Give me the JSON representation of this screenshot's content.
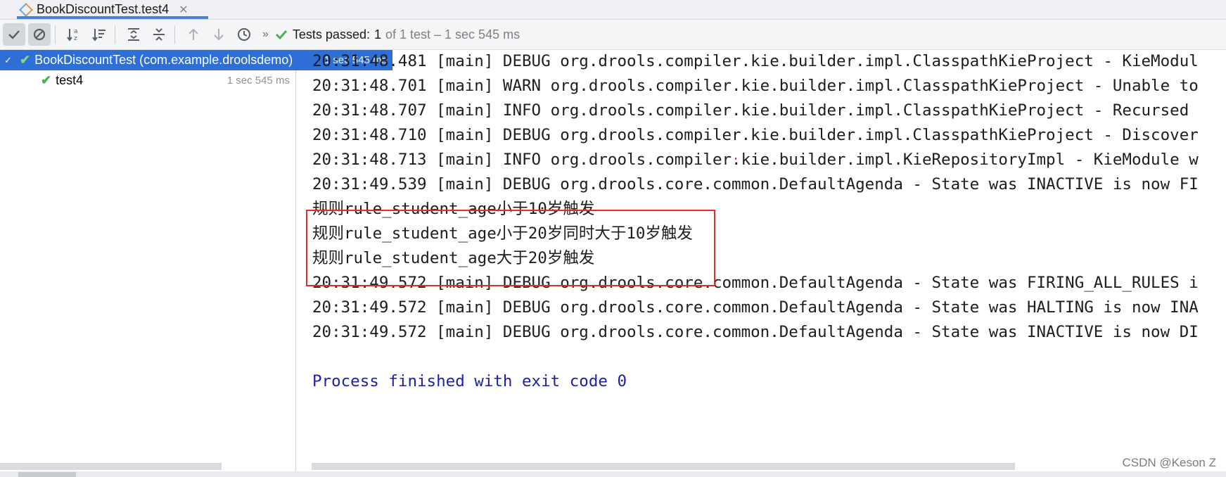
{
  "tab": {
    "title": "BookDiscountTest.test4"
  },
  "toolbar": {
    "status_prefix": "Tests passed:",
    "status_count": "1",
    "status_rest": "of 1 test – 1 sec 545 ms"
  },
  "tree": {
    "root_label": "BookDiscountTest (com.example.droolsdemo)",
    "root_time": "1 sec 545 ms",
    "child_label": "test4",
    "child_time": "1 sec 545 ms"
  },
  "console": {
    "lines": [
      "20:31:48.481 [main] DEBUG org.drools.compiler.kie.builder.impl.ClasspathKieProject - KieModul",
      "20:31:48.701 [main] WARN org.drools.compiler.kie.builder.impl.ClasspathKieProject - Unable to",
      "20:31:48.707 [main] INFO org.drools.compiler.kie.builder.impl.ClasspathKieProject - Recursed",
      "20:31:48.710 [main] DEBUG org.drools.compiler.kie.builder.impl.ClasspathKieProject - Discover",
      "20:31:48.713 [main] INFO org.drools.compiler.kie.builder.impl.KieRepositoryImpl - KieModule w",
      "20:31:49.539 [main] DEBUG org.drools.core.common.DefaultAgenda - State was INACTIVE is now FI",
      "规则rule_student_age小于10岁触发",
      "规则rule_student_age小于20岁同时大于10岁触发",
      "规则rule_student_age大于20岁触发",
      "20:31:49.572 [main] DEBUG org.drools.core.common.DefaultAgenda - State was FIRING_ALL_RULES i",
      "20:31:49.572 [main] DEBUG org.drools.core.common.DefaultAgenda - State was HALTING is now INA",
      "20:31:49.572 [main] DEBUG org.drools.core.common.DefaultAgenda - State was INACTIVE is now DI"
    ],
    "exit_line": "Process finished with exit code 0"
  },
  "watermark": "CSDN @Keson Z",
  "icons": [
    "check-icon",
    "cancel-icon",
    "sort-alpha-icon",
    "sort-duration-icon",
    "expand-all-icon",
    "collapse-all-icon",
    "prev-failed-icon",
    "next-failed-icon",
    "history-icon"
  ],
  "colors": {
    "selection": "#2d6fd7",
    "pass_green": "#4caf50",
    "highlight_box": "#e22d2d",
    "exit_text": "#1e1ea8"
  }
}
